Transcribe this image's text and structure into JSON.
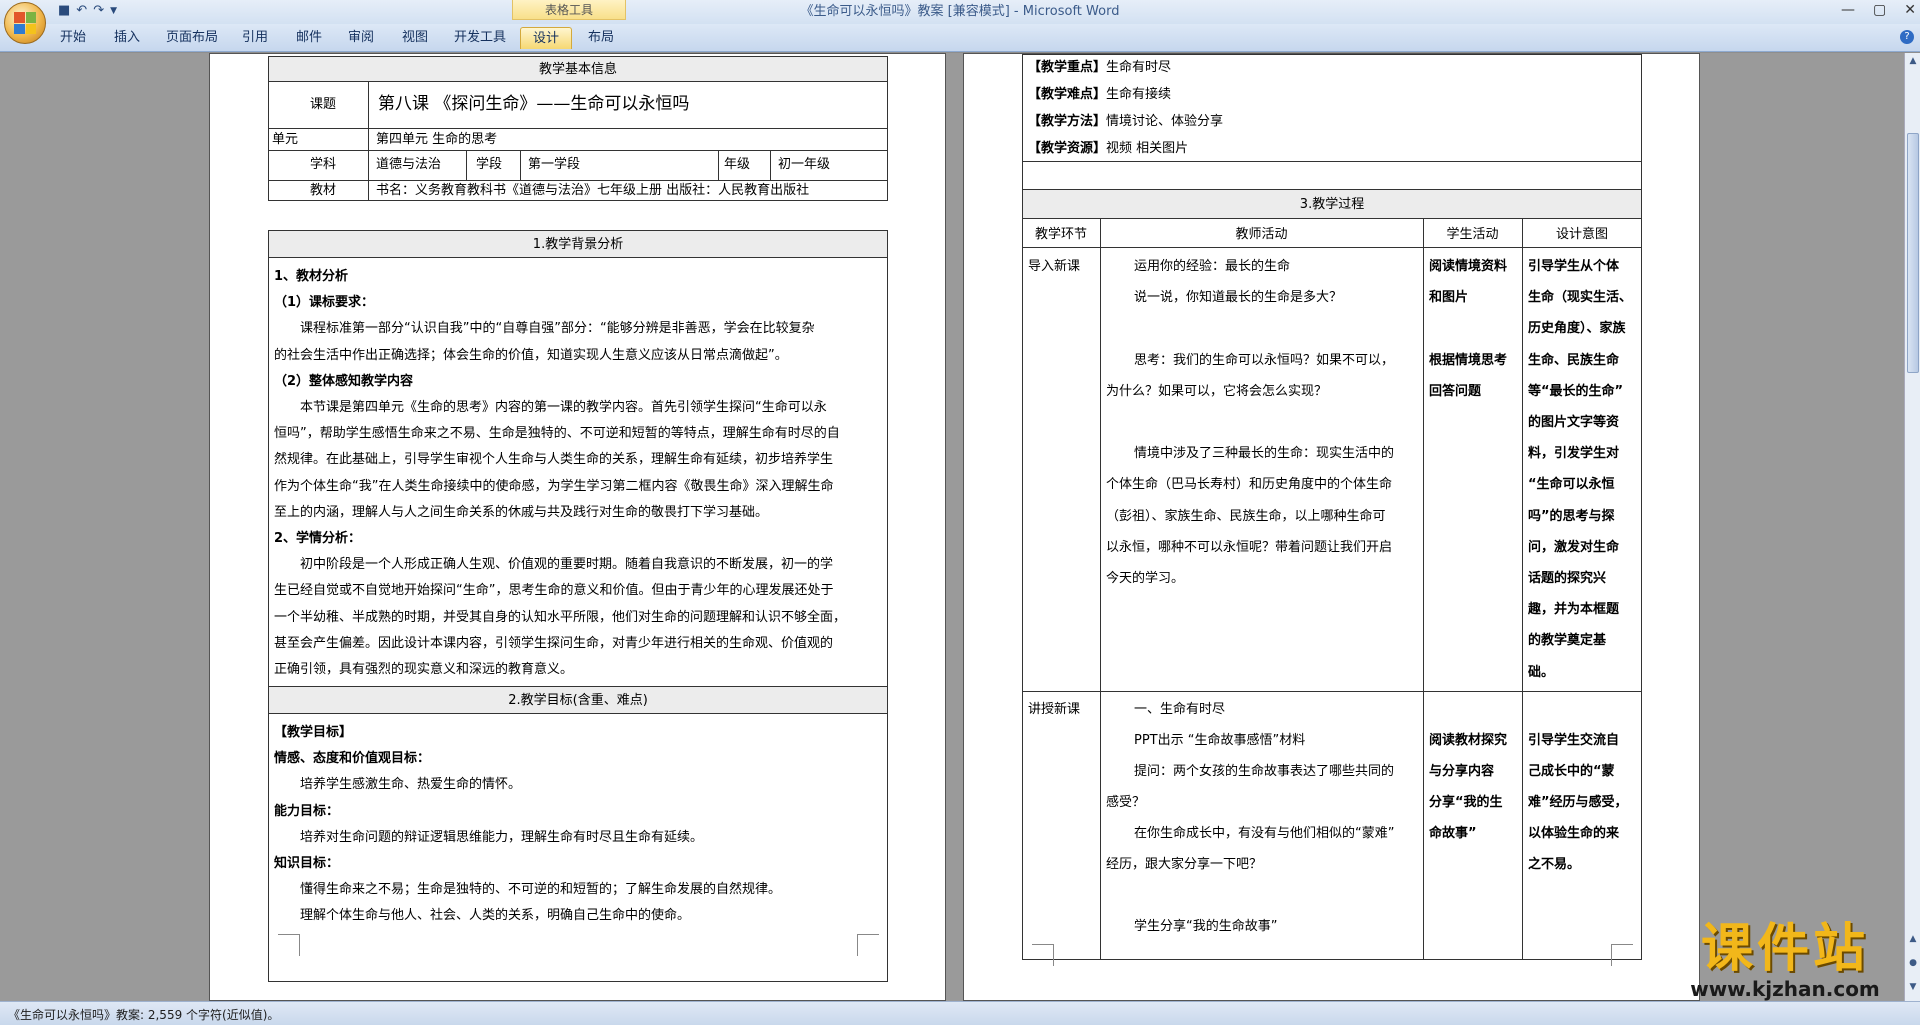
{
  "window": {
    "title": "《生命可以永恒吗》教案 [兼容模式] - Microsoft Word",
    "context_tab": "表格工具"
  },
  "ribbon": {
    "tabs": [
      "开始",
      "插入",
      "页面布局",
      "引用",
      "邮件",
      "审阅",
      "视图",
      "开发工具",
      "设计",
      "布局"
    ]
  },
  "status": {
    "text": "《生命可以永恒吗》教案: 2,559 个字符(近似值)。"
  },
  "watermark": {
    "text": "课件站",
    "url": "www.kjzhan.com"
  },
  "page1": {
    "info_header": "教学基本信息",
    "course_label": "课题",
    "course_value": "第八课 《探问生命》——生命可以永恒吗",
    "unit_label": "单元",
    "unit_value": "第四单元 生命的思考",
    "subject_label": "学科",
    "subject_value": "道德与法治",
    "stage_label": "学段",
    "stage_value": "第一学段",
    "grade_label": "年级",
    "grade_value": "初一年级",
    "textbook_label": "教材",
    "textbook_value": "书名：义务教育教科书《道德与法治》七年级上册   出版社：人民教育出版社",
    "bg_header": "1.教学背景分析",
    "bg_lines": [
      {
        "t": "1、教材分析",
        "bold": true,
        "ind": 0
      },
      {
        "t": "（1）课标要求：",
        "bold": true,
        "ind": 0
      },
      {
        "t": "课程标准第一部分“认识自我”中的“自尊自强”部分：“能够分辨是非善恶，学会在比较复杂",
        "bold": false,
        "ind": 1
      },
      {
        "t": "的社会生活中作出正确选择；体会生命的价值，知道实现人生意义应该从日常点滴做起”。",
        "bold": false,
        "ind": 0
      },
      {
        "t": "（2）整体感知教学内容",
        "bold": true,
        "ind": 0
      },
      {
        "t": "本节课是第四单元《生命的思考》内容的第一课的教学内容。首先引领学生探问“生命可以永",
        "bold": false,
        "ind": 1
      },
      {
        "t": "恒吗”，帮助学生感悟生命来之不易、生命是独特的、不可逆和短暂的等特点，理解生命有时尽的自",
        "bold": false,
        "ind": 0
      },
      {
        "t": "然规律。在此基础上，引导学生审视个人生命与人类生命的关系，理解生命有延续，初步培养学生",
        "bold": false,
        "ind": 0
      },
      {
        "t": "作为个体生命“我”在人类生命接续中的使命感，为学生学习第二框内容《敬畏生命》深入理解生命",
        "bold": false,
        "ind": 0
      },
      {
        "t": "至上的内涵，理解人与人之间生命关系的休戚与共及践行对生命的敬畏打下学习基础。",
        "bold": false,
        "ind": 0
      },
      {
        "t": "2、学情分析：",
        "bold": true,
        "ind": 0
      },
      {
        "t": "初中阶段是一个人形成正确人生观、价值观的重要时期。随着自我意识的不断发展，初一的学",
        "bold": false,
        "ind": 1
      },
      {
        "t": "生已经自觉或不自觉地开始探问“生命”，思考生命的意义和价值。但由于青少年的心理发展还处于",
        "bold": false,
        "ind": 0
      },
      {
        "t": "一个半幼稚、半成熟的时期，并受其自身的认知水平所限，他们对生命的问题理解和认识不够全面，",
        "bold": false,
        "ind": 0
      },
      {
        "t": "甚至会产生偏差。因此设计本课内容，引领学生探问生命，对青少年进行相关的生命观、价值观的",
        "bold": false,
        "ind": 0
      },
      {
        "t": "正确引领，具有强烈的现实意义和深远的教育意义。",
        "bold": false,
        "ind": 0
      }
    ],
    "goal_header": "2.教学目标(含重、难点)",
    "goal_lines": [
      {
        "t": "【教学目标】",
        "bold": true,
        "ind": 0
      },
      {
        "t": "情感、态度和价值观目标：",
        "bold": true,
        "ind": 0
      },
      {
        "t": "培养学生感激生命、热爱生命的情怀。",
        "bold": false,
        "ind": 1
      },
      {
        "t": "能力目标：",
        "bold": true,
        "ind": 0
      },
      {
        "t": "培养对生命问题的辩证逻辑思维能力，理解生命有时尽且生命有延续。",
        "bold": false,
        "ind": 1
      },
      {
        "t": "知识目标：",
        "bold": true,
        "ind": 0
      },
      {
        "t": "懂得生命来之不易；生命是独特的、不可逆的和短暂的；了解生命发展的自然规律。",
        "bold": false,
        "ind": 1
      },
      {
        "t": "理解个体生命与他人、社会、人类的关系，明确自己生命中的使命。",
        "bold": false,
        "ind": 1
      }
    ]
  },
  "page2": {
    "top_lines": [
      {
        "k": "【教学重点】",
        "v": "生命有时尽"
      },
      {
        "k": "【教学难点】",
        "v": "生命有接续"
      },
      {
        "k": "【教学方法】",
        "v": "情境讨论、体验分享"
      },
      {
        "k": "【教学资源】",
        "v": "视频 相关图片"
      }
    ],
    "process_header": "3.教学过程",
    "cols": [
      "教学环节",
      "教师活动",
      "学生活动",
      "设计意图"
    ],
    "row1": {
      "stage": "导入新课",
      "teacher": [
        {
          "t": "运用你的经验：最长的生命",
          "ind": 1
        },
        {
          "t": "说一说，你知道最长的生命是多大？",
          "ind": 1
        },
        {
          "t": "",
          "ind": 0
        },
        {
          "t": "思考：我们的生命可以永恒吗？如果不可以，",
          "ind": 1
        },
        {
          "t": "为什么？如果可以，它将会怎么实现？",
          "ind": 0
        },
        {
          "t": "",
          "ind": 0
        },
        {
          "t": "情境中涉及了三种最长的生命：现实生活中的",
          "ind": 1
        },
        {
          "t": "个体生命（巴马长寿村）和历史角度中的个体生命",
          "ind": 0
        },
        {
          "t": "（彭祖）、家族生命、民族生命，以上哪种生命可",
          "ind": 0
        },
        {
          "t": "以永恒，哪种不可以永恒呢？带着问题让我们开启",
          "ind": 0
        },
        {
          "t": "今天的学习。",
          "ind": 0
        }
      ],
      "student": [
        "阅读情境资料",
        "和图片",
        "",
        "根据情境思考",
        "回答问题"
      ],
      "intent": [
        "引导学生从个体",
        "生命（现实生活、",
        "历史角度）、家族",
        "生命、民族生命",
        "等“最长的生命”",
        "的图片文字等资",
        "料，引发学生对",
        "“生命可以永恒",
        "吗”的思考与探",
        "问，激发对生命",
        "话题的探究兴",
        "趣，并为本框题",
        "的教学奠定基",
        "础。"
      ]
    },
    "row2": {
      "stage": "讲授新课",
      "teacher": [
        {
          "t": "一、生命有时尽",
          "ind": 1
        },
        {
          "t": "PPT出示 “生命故事感悟”材料",
          "ind": 1
        },
        {
          "t": "提问：两个女孩的生命故事表达了哪些共同的",
          "ind": 1
        },
        {
          "t": "感受？",
          "ind": 0
        },
        {
          "t": "在你生命成长中，有没有与他们相似的“蒙难”",
          "ind": 1
        },
        {
          "t": "经历，跟大家分享一下吧？",
          "ind": 0
        },
        {
          "t": "",
          "ind": 0
        },
        {
          "t": "学生分享“我的生命故事”",
          "ind": 1
        }
      ],
      "student": [
        "",
        "阅读教材探究",
        "与分享内容",
        "分享“我的生",
        "命故事”",
        "",
        ""
      ],
      "intent": [
        "",
        "引导学生交流自",
        "己成长中的“蒙",
        "难”经历与感受，",
        "以体验生命的来",
        "之不易。",
        "",
        ""
      ]
    }
  }
}
